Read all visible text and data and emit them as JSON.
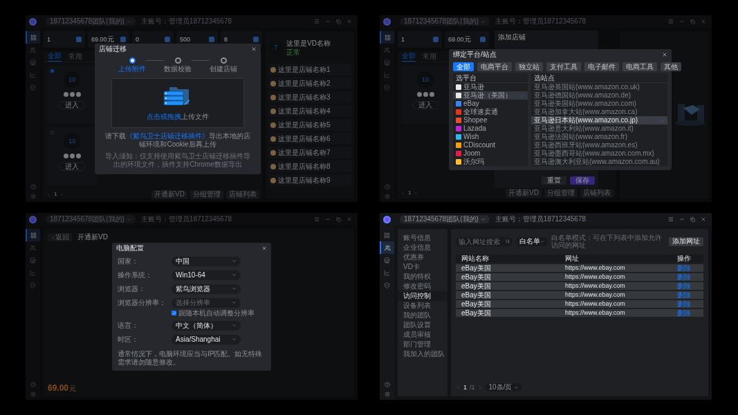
{
  "store_migration": {
    "topbar": {
      "account": "18712345678团队(我的)",
      "main_account": "主账号：管理员18712345678"
    },
    "nav": [
      {
        "selected": true
      },
      {
        "selected": false
      },
      {
        "selected": false
      },
      {
        "selected": false
      },
      {
        "selected": false
      }
    ],
    "stats": [
      {
        "value": "1"
      },
      {
        "value": "69.00",
        "unit": "元"
      },
      {
        "value": "0"
      },
      {
        "value": "500"
      },
      {
        "value": "8"
      }
    ],
    "tabs": [
      {
        "label": "全部",
        "selected": true
      },
      {
        "label": "常用",
        "selected": false
      }
    ],
    "cards": [
      {
        "os": "10",
        "starred": true,
        "button": "进入"
      },
      {
        "os": "10",
        "starred": false,
        "button": "进入"
      }
    ],
    "page": "1",
    "footer_buttons": [
      "开通新VD",
      "分组管理",
      "店铺列表"
    ],
    "vd": {
      "name": "这里是VD名称",
      "os": "7",
      "status": "正常"
    },
    "stores": [
      "这里是店铺名称1",
      "这里是店铺名称2",
      "这里是店铺名称3",
      "这里是店铺名称4",
      "这里是店铺名称5",
      "这里是店铺名称6",
      "这里是店铺名称7",
      "这里是店铺名称8",
      "这里是店铺名称9"
    ],
    "dialog": {
      "title": "店铺迁移",
      "steps": [
        {
          "label": "上传附件",
          "selected": true
        },
        {
          "label": "数据校验",
          "selected": false
        },
        {
          "label": "创建店铺",
          "selected": false
        }
      ],
      "upload_link": "点击或拖拽",
      "upload_text": "上传文件",
      "note_before": "请下载",
      "note_link": "《紫鸟卫士店铺迁移插件》",
      "note_after": "导出本地的店铺环境和Cookie后再上传",
      "import_note": "导入须知：仅支持使用紫鸟卫士店铺迁移插件导出的环境文件，插件支持Chrome数据导出"
    }
  },
  "bind_platform": {
    "topbar": {
      "account": "18712345678团队(我的)",
      "main_account": "主账号：管理员18712345678"
    },
    "nav": [
      {
        "selected": true
      },
      {
        "selected": false
      },
      {
        "selected": false
      },
      {
        "selected": false
      },
      {
        "selected": false
      }
    ],
    "stats": [
      {
        "value": "1"
      },
      {
        "value": "69.00",
        "unit": "元"
      }
    ],
    "tabs": [
      {
        "label": "全部",
        "selected": true
      },
      {
        "label": "常用",
        "selected": false
      }
    ],
    "card": {
      "os": "10",
      "button": "进入"
    },
    "page": "1",
    "footer_buttons": [
      "开通新VD",
      "分组管理",
      "店铺列表"
    ],
    "back_dialog": {
      "title": "添加店铺",
      "buttons": [
        "重置",
        "保存"
      ]
    },
    "dialog": {
      "title": "绑定平台/站点",
      "categories": [
        {
          "label": "全部",
          "selected": true
        },
        {
          "label": "电商平台",
          "selected": false
        },
        {
          "label": "独立站",
          "selected": false
        },
        {
          "label": "支付工具",
          "selected": false
        },
        {
          "label": "电子邮件",
          "selected": false
        },
        {
          "label": "电商工具",
          "selected": false
        },
        {
          "label": "其他",
          "selected": false
        }
      ],
      "platform_header": "选平台",
      "platforms": [
        {
          "name": "亚马逊",
          "selected": false,
          "color": "#e8e8e8"
        },
        {
          "name": "亚马逊（美国）",
          "selected": true,
          "color": "#e8e8e8"
        },
        {
          "name": "eBay",
          "selected": false,
          "color": "#3b82f6"
        },
        {
          "name": "全球速卖通",
          "selected": false,
          "color": "#e5341d"
        },
        {
          "name": "Shopee",
          "selected": false,
          "color": "#ee4d2d"
        },
        {
          "name": "Lazada",
          "selected": false,
          "color": "#c026d3"
        },
        {
          "name": "Wish",
          "selected": false,
          "color": "#2fb7ec"
        },
        {
          "name": "CDiscount",
          "selected": false,
          "color": "#f59e0b"
        },
        {
          "name": "Joom",
          "selected": false,
          "color": "#e11d48"
        },
        {
          "name": "沃尔玛",
          "selected": false,
          "color": "#fbbf24"
        }
      ],
      "site_header": "选站点",
      "sites": [
        {
          "name": "亚马逊英国站(www.amazon.co.uk)",
          "selected": false
        },
        {
          "name": "亚马逊德国站(www.amazon.de)",
          "selected": false
        },
        {
          "name": "亚马逊美国站(www.amazon.com)",
          "selected": false
        },
        {
          "name": "亚马逊加拿大站(www.amazon.ca)",
          "selected": false
        },
        {
          "name": "亚马逊日本站(www.amazon.co.jp)",
          "selected": true
        },
        {
          "name": "亚马逊意大利站(www.amazon.it)",
          "selected": false
        },
        {
          "name": "亚马逊法国站(www.amazon.fr)",
          "selected": false
        },
        {
          "name": "亚马逊西班牙站(www.amazon.es)",
          "selected": false
        },
        {
          "name": "亚马逊墨西哥站(www.amazon.com.mx)",
          "selected": false
        },
        {
          "name": "亚马逊澳大利亚站(www.amazon.com.au)",
          "selected": false
        }
      ]
    }
  },
  "computer_config": {
    "topbar": {
      "account": "18712345678团队(我的)",
      "main_account": "主账号：管理员18712345678"
    },
    "nav": [
      {
        "selected": true
      },
      {
        "selected": false
      },
      {
        "selected": false
      },
      {
        "selected": false
      },
      {
        "selected": false
      }
    ],
    "back": "返回",
    "title": "开通新VD",
    "price": "69.00",
    "unit": "元",
    "dialog": {
      "title": "电脑配置",
      "fields": [
        {
          "label": "国家：",
          "value": "中国"
        },
        {
          "label": "操作系统：",
          "value": "Win10-64"
        },
        {
          "label": "浏览器：",
          "value": "紫鸟浏览器"
        },
        {
          "label": "浏览器分辨率：",
          "placeholder": "选择分辨率",
          "option": {
            "label": "跟随本机自动调整分辨率",
            "checked": true
          }
        },
        {
          "label": "语言：",
          "value": "中文（简体）"
        },
        {
          "label": "时区：",
          "value": "Asia/Shanghai"
        }
      ],
      "note": "通常情况下，电脑环境应当与IP匹配。如无特殊需求请勿随意修改。"
    }
  },
  "access_control": {
    "topbar": {
      "account": "18712345678团队(我的)",
      "main_account": "主账号：管理员18712345678"
    },
    "nav": [
      {
        "selected": false
      },
      {
        "selected": true
      },
      {
        "selected": false
      },
      {
        "selected": false
      },
      {
        "selected": false
      }
    ],
    "menu": [
      {
        "label": "账号信息",
        "selected": false
      },
      {
        "label": "企业信息",
        "selected": false
      },
      {
        "label": "优惠券",
        "selected": false
      },
      {
        "label": "VD卡",
        "selected": false
      },
      {
        "label": "我的特权",
        "selected": false
      },
      {
        "label": "修改密码",
        "selected": false
      },
      {
        "label": "访问控制",
        "selected": true
      },
      {
        "label": "设备列表",
        "selected": false
      },
      {
        "label": "我的团队",
        "selected": false
      },
      {
        "label": "团队设置",
        "selected": false
      },
      {
        "label": "成员审核",
        "selected": false
      },
      {
        "label": "部门管理",
        "selected": false
      },
      {
        "label": "我加入的团队",
        "selected": false
      }
    ],
    "search": {
      "placeholder": "输入网址搜索"
    },
    "mode": "白名单",
    "hint": "白名单模式：可在下列表中添加允许访问的网址",
    "add_button": "添加网址",
    "columns": [
      "网站名称",
      "网址",
      "操作"
    ],
    "rows": [
      {
        "name": "eBay美国",
        "url": "https://www.ebay.com",
        "action": "删除"
      },
      {
        "name": "eBay美国",
        "url": "https://www.ebay.com",
        "action": "删除"
      },
      {
        "name": "eBay美国",
        "url": "https://www.ebay.com",
        "action": "删除"
      },
      {
        "name": "eBay美国",
        "url": "https://www.ebay.com",
        "action": "删除"
      },
      {
        "name": "eBay美国",
        "url": "https://www.ebay.com",
        "action": "删除"
      },
      {
        "name": "eBay美国",
        "url": "https://www.ebay.com",
        "action": "删除"
      }
    ],
    "pager": {
      "page": "1",
      "total": "/1",
      "size": "10条/页"
    }
  }
}
